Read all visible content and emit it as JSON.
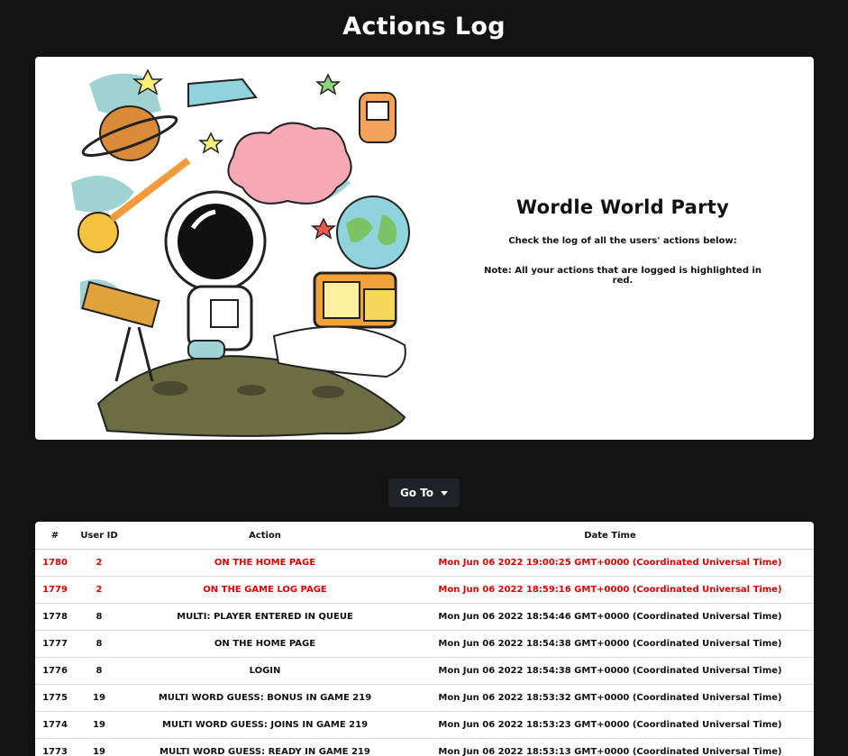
{
  "page": {
    "title": "Actions Log"
  },
  "hero": {
    "heading": "Wordle World Party",
    "subtitle": "Check the log of all the users' actions below:",
    "note": "Note: All your actions that are logged is highlighted in red."
  },
  "goto": {
    "label": "Go To"
  },
  "table": {
    "headers": [
      "#",
      "User ID",
      "Action",
      "Date Time"
    ],
    "rows": [
      {
        "id": "1780",
        "user": "2",
        "action": "ON THE HOME PAGE",
        "time": "Mon Jun 06 2022 19:00:25 GMT+0000 (Coordinated Universal Time)",
        "highlight": true
      },
      {
        "id": "1779",
        "user": "2",
        "action": "ON THE GAME LOG PAGE",
        "time": "Mon Jun 06 2022 18:59:16 GMT+0000 (Coordinated Universal Time)",
        "highlight": true
      },
      {
        "id": "1778",
        "user": "8",
        "action": "MULTI: PLAYER ENTERED IN QUEUE",
        "time": "Mon Jun 06 2022 18:54:46 GMT+0000 (Coordinated Universal Time)",
        "highlight": false
      },
      {
        "id": "1777",
        "user": "8",
        "action": "ON THE HOME PAGE",
        "time": "Mon Jun 06 2022 18:54:38 GMT+0000 (Coordinated Universal Time)",
        "highlight": false
      },
      {
        "id": "1776",
        "user": "8",
        "action": "LOGIN",
        "time": "Mon Jun 06 2022 18:54:38 GMT+0000 (Coordinated Universal Time)",
        "highlight": false
      },
      {
        "id": "1775",
        "user": "19",
        "action": "MULTI WORD GUESS: BONUS IN GAME 219",
        "time": "Mon Jun 06 2022 18:53:32 GMT+0000 (Coordinated Universal Time)",
        "highlight": false
      },
      {
        "id": "1774",
        "user": "19",
        "action": "MULTI WORD GUESS: JOINS IN GAME 219",
        "time": "Mon Jun 06 2022 18:53:23 GMT+0000 (Coordinated Universal Time)",
        "highlight": false
      },
      {
        "id": "1773",
        "user": "19",
        "action": "MULTI WORD GUESS: READY IN GAME 219",
        "time": "Mon Jun 06 2022 18:53:13 GMT+0000 (Coordinated Universal Time)",
        "highlight": false
      }
    ]
  },
  "colors": {
    "background": "#131313",
    "highlight": "#e00000",
    "button": "#1f2226"
  }
}
